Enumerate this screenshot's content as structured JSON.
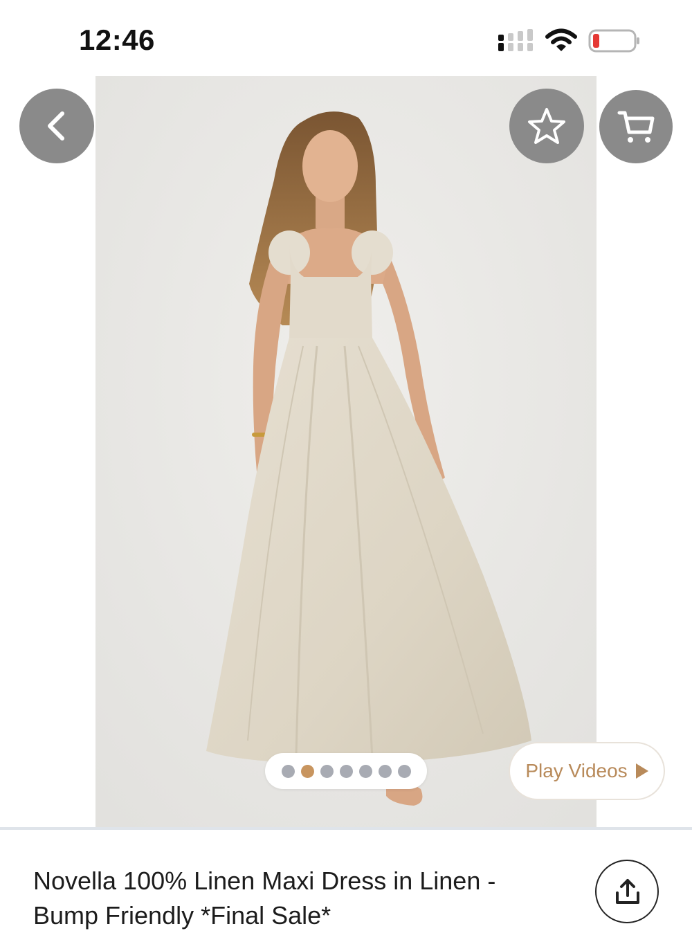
{
  "status_bar": {
    "time": "12:46"
  },
  "gallery": {
    "dot_count": 7,
    "active_dot": 1,
    "play_videos_label": "Play Videos"
  },
  "product": {
    "title": "Novella 100% Linen Maxi Dress in Linen - Bump Friendly *Final Sale*"
  },
  "colors": {
    "accent": "#c8955f",
    "icon_button_bg": "#8a8a8a",
    "battery_low": "#e53935"
  }
}
